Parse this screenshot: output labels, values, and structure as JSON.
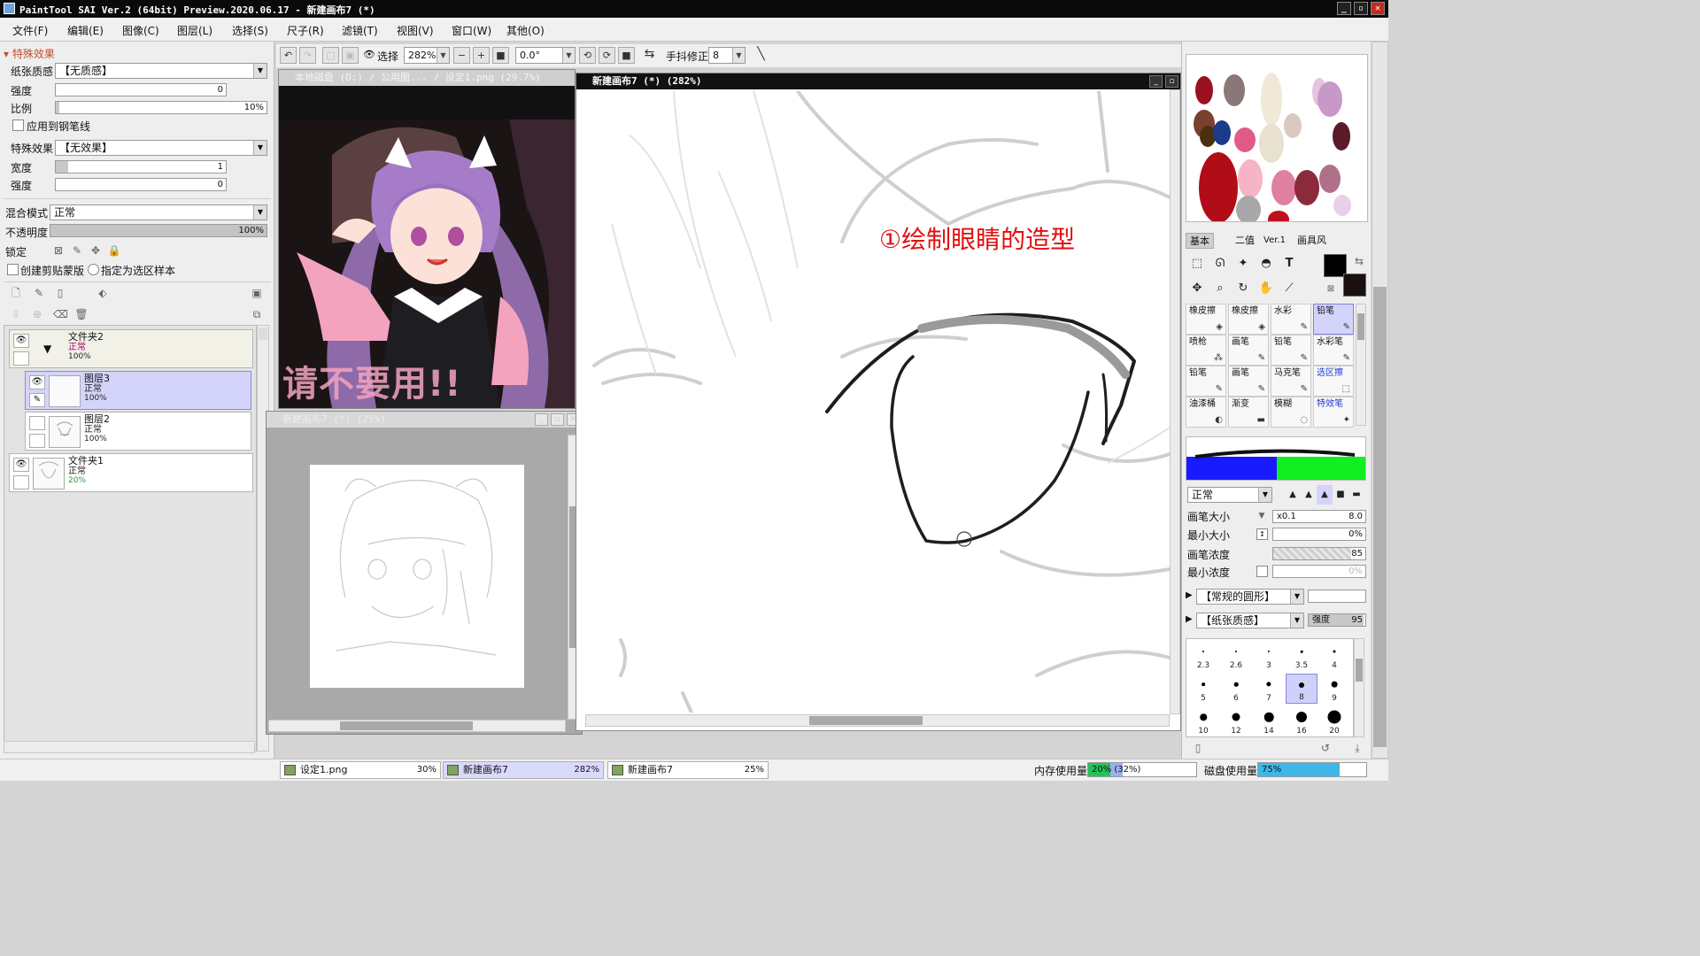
{
  "app": {
    "title": "PaintTool SAI Ver.2 (64bit) Preview.2020.06.17 - 新建画布7 (*)"
  },
  "menu": [
    "文件(F)",
    "编辑(E)",
    "图像(C)",
    "图层(L)",
    "选择(S)",
    "尺子(R)",
    "滤镜(T)",
    "视图(V)",
    "窗口(W)",
    "其他(O)"
  ],
  "toolbar": {
    "select_label": "选择",
    "zoom": "282%",
    "rotation": "0.0°",
    "stabilizer_label": "手抖修正",
    "stabilizer_value": "8"
  },
  "left": {
    "section_title": "特殊效果",
    "paper_texture_label": "纸张质感",
    "paper_texture_value": "【无质感】",
    "strength_label": "强度",
    "strength_value": "0",
    "scale_label": "比例",
    "scale_value": "10%",
    "apply_to_line_label": "应用到钢笔线",
    "effect_label": "特殊效果",
    "effect_value": "【无效果】",
    "width_label": "宽度",
    "width_value": "1",
    "strength2_label": "强度",
    "strength2_value": "0",
    "blend_label": "混合模式",
    "blend_value": "正常",
    "opacity_label": "不透明度",
    "opacity_value": "100%",
    "lock_label": "锁定",
    "clip_label": "创建剪贴蒙版",
    "selection_source_label": "指定为选区样本"
  },
  "layers": [
    {
      "name": "文件夹2",
      "mode": "正常",
      "opacity": "100%"
    },
    {
      "name": "图层3",
      "mode": "正常",
      "opacity": "100%"
    },
    {
      "name": "图层2",
      "mode": "正常",
      "opacity": "100%"
    },
    {
      "name": "文件夹1",
      "mode": "正常",
      "opacity": "20%"
    }
  ],
  "windows": {
    "reference": {
      "title": "本地磁盘 (D:) / 公用图... / 设定1.png (29.7%)",
      "watermark": "请不要用!!"
    },
    "navigator": {
      "title": "新建画布7 (*) (25%)"
    },
    "main": {
      "title": "新建画布7 (*) (282%)",
      "annotation": "①绘制眼睛的造型"
    }
  },
  "right": {
    "tabs": [
      "基本",
      "二值",
      "Ver.1",
      "画具风"
    ],
    "brushes": [
      {
        "label": "橡皮擦"
      },
      {
        "label": "橡皮擦"
      },
      {
        "label": "水彩"
      },
      {
        "label": "铅笔"
      },
      {
        "label": "喷枪"
      },
      {
        "label": "画笔"
      },
      {
        "label": "铅笔"
      },
      {
        "label": "水彩笔"
      },
      {
        "label": "铅笔"
      },
      {
        "label": "画笔"
      },
      {
        "label": "马克笔"
      },
      {
        "label": "选区擦"
      },
      {
        "label": "油漆桶"
      },
      {
        "label": "渐变"
      },
      {
        "label": "模糊"
      },
      {
        "label": "特效笔"
      }
    ],
    "blend_value": "正常",
    "brush_size_label": "画笔大小",
    "brush_size_mult": "x0.1",
    "brush_size_value": "8.0",
    "min_size_label": "最小大小",
    "min_size_value": "0%",
    "density_label": "画笔浓度",
    "density_value": "85",
    "min_density_label": "最小浓度",
    "min_density_value": "0%",
    "shape_value": "【常规的圆形】",
    "texture_value": "【纸张质感】",
    "texture_strength_label": "强度",
    "texture_strength_value": "95",
    "sizes": [
      "2.3",
      "2.6",
      "3",
      "3.5",
      "4",
      "5",
      "6",
      "7",
      "8",
      "9",
      "10",
      "12",
      "14",
      "16",
      "20"
    ]
  },
  "bottom": {
    "tabs": [
      {
        "name": "设定1.png",
        "pct": "30%"
      },
      {
        "name": "新建画布7",
        "pct": "282%"
      },
      {
        "name": "新建画布7",
        "pct": "25%"
      }
    ],
    "memory_label": "内存使用量",
    "memory_value": "20% (32%)",
    "disk_label": "磁盘使用量",
    "disk_value": "75%"
  },
  "colors": {
    "accent_pink": "#e05a8a",
    "annotation_red": "#e01010",
    "selected_blue": "#d4d4fb"
  }
}
